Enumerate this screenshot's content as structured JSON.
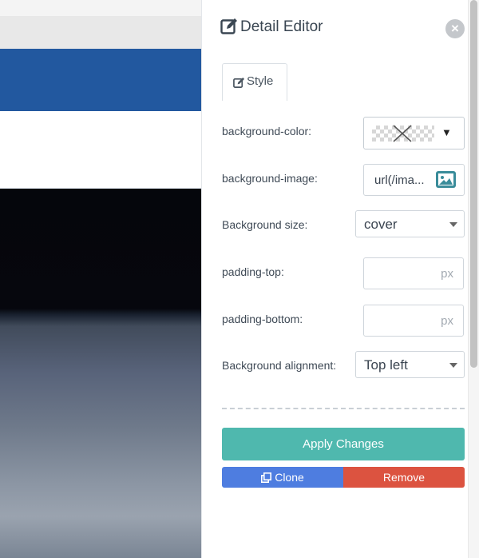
{
  "panel": {
    "title": "Detail Editor",
    "close_glyph": "×",
    "tabs": [
      {
        "label": "Style",
        "icon": "edit-icon"
      }
    ]
  },
  "fields": {
    "background_color": {
      "label": "background-color:"
    },
    "background_image": {
      "label": "background-image:",
      "value": "url(/ima..."
    },
    "background_size": {
      "label": "Background size:",
      "value": "cover"
    },
    "padding_top": {
      "label": "padding-top:",
      "unit": "px"
    },
    "padding_bottom": {
      "label": "padding-bottom:",
      "unit": "px"
    },
    "background_alignment": {
      "label": "Background alignment:",
      "value": "Top left"
    }
  },
  "buttons": {
    "apply": "Apply Changes",
    "clone": "Clone",
    "remove": "Remove"
  },
  "colors": {
    "apply": "#4fb8ae",
    "clone": "#4e7de0",
    "remove": "#dc5340",
    "canvas_band": "#22589f"
  }
}
